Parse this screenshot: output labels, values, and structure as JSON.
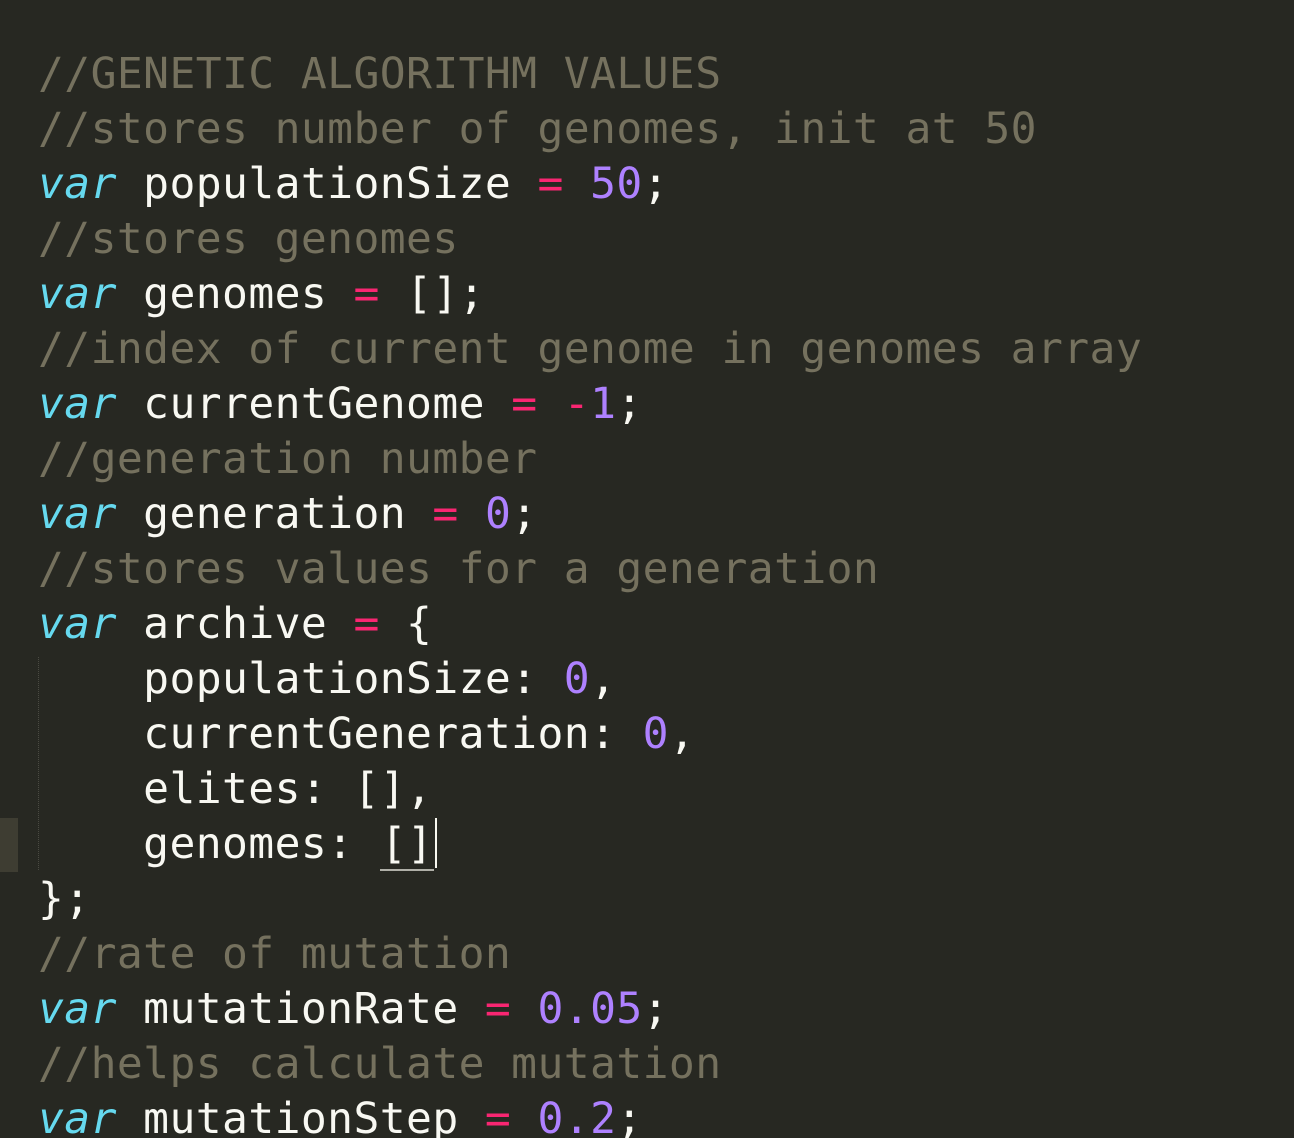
{
  "editor": {
    "theme": {
      "background": "#272822",
      "comment": "#75715e",
      "keyword": "#66d9ef",
      "operator": "#f92672",
      "number": "#ae81ff",
      "text": "#f8f8f2"
    },
    "lines": [
      {
        "tokens": [
          {
            "type": "comment",
            "text": "//GENETIC ALGORITHM VALUES"
          }
        ]
      },
      {
        "tokens": [
          {
            "type": "comment",
            "text": "//stores number of genomes, init at 50"
          }
        ]
      },
      {
        "tokens": [
          {
            "type": "keyword",
            "text": "var"
          },
          {
            "type": "ident",
            "text": " populationSize "
          },
          {
            "type": "op",
            "text": "="
          },
          {
            "type": "ident",
            "text": " "
          },
          {
            "type": "number",
            "text": "50"
          },
          {
            "type": "punct",
            "text": ";"
          }
        ]
      },
      {
        "tokens": [
          {
            "type": "comment",
            "text": "//stores genomes"
          }
        ]
      },
      {
        "tokens": [
          {
            "type": "keyword",
            "text": "var"
          },
          {
            "type": "ident",
            "text": " genomes "
          },
          {
            "type": "op",
            "text": "="
          },
          {
            "type": "punct",
            "text": " [];"
          }
        ]
      },
      {
        "tokens": [
          {
            "type": "comment",
            "text": "//index of current genome in genomes array"
          }
        ]
      },
      {
        "tokens": [
          {
            "type": "keyword",
            "text": "var"
          },
          {
            "type": "ident",
            "text": " currentGenome "
          },
          {
            "type": "op",
            "text": "="
          },
          {
            "type": "ident",
            "text": " "
          },
          {
            "type": "op",
            "text": "-"
          },
          {
            "type": "number",
            "text": "1"
          },
          {
            "type": "punct",
            "text": ";"
          }
        ]
      },
      {
        "tokens": [
          {
            "type": "comment",
            "text": "//generation number"
          }
        ]
      },
      {
        "tokens": [
          {
            "type": "keyword",
            "text": "var"
          },
          {
            "type": "ident",
            "text": " generation "
          },
          {
            "type": "op",
            "text": "="
          },
          {
            "type": "ident",
            "text": " "
          },
          {
            "type": "number",
            "text": "0"
          },
          {
            "type": "punct",
            "text": ";"
          }
        ]
      },
      {
        "tokens": [
          {
            "type": "comment",
            "text": "//stores values for a generation"
          }
        ]
      },
      {
        "tokens": [
          {
            "type": "keyword",
            "text": "var"
          },
          {
            "type": "ident",
            "text": " archive "
          },
          {
            "type": "op",
            "text": "="
          },
          {
            "type": "punct",
            "text": " {"
          }
        ]
      },
      {
        "tokens": [
          {
            "type": "ident",
            "text": "    populationSize: "
          },
          {
            "type": "number",
            "text": "0"
          },
          {
            "type": "punct",
            "text": ","
          }
        ]
      },
      {
        "tokens": [
          {
            "type": "ident",
            "text": "    currentGeneration: "
          },
          {
            "type": "number",
            "text": "0"
          },
          {
            "type": "punct",
            "text": ","
          }
        ]
      },
      {
        "tokens": [
          {
            "type": "ident",
            "text": "    elites: [],"
          }
        ]
      },
      {
        "tokens": [
          {
            "type": "ident",
            "text": "    genomes: "
          },
          {
            "type": "bracket",
            "text": "[]"
          }
        ],
        "cursor": true
      },
      {
        "tokens": [
          {
            "type": "punct",
            "text": "};"
          }
        ]
      },
      {
        "tokens": [
          {
            "type": "comment",
            "text": "//rate of mutation"
          }
        ]
      },
      {
        "tokens": [
          {
            "type": "keyword",
            "text": "var"
          },
          {
            "type": "ident",
            "text": " mutationRate "
          },
          {
            "type": "op",
            "text": "="
          },
          {
            "type": "ident",
            "text": " "
          },
          {
            "type": "number",
            "text": "0.05"
          },
          {
            "type": "punct",
            "text": ";"
          }
        ]
      },
      {
        "tokens": [
          {
            "type": "comment",
            "text": "//helps calculate mutation"
          }
        ]
      },
      {
        "tokens": [
          {
            "type": "keyword",
            "text": "var"
          },
          {
            "type": "ident",
            "text": " mutationStep "
          },
          {
            "type": "op",
            "text": "="
          },
          {
            "type": "ident",
            "text": " "
          },
          {
            "type": "number",
            "text": "0.2"
          },
          {
            "type": "punct",
            "text": ";"
          }
        ]
      }
    ]
  }
}
